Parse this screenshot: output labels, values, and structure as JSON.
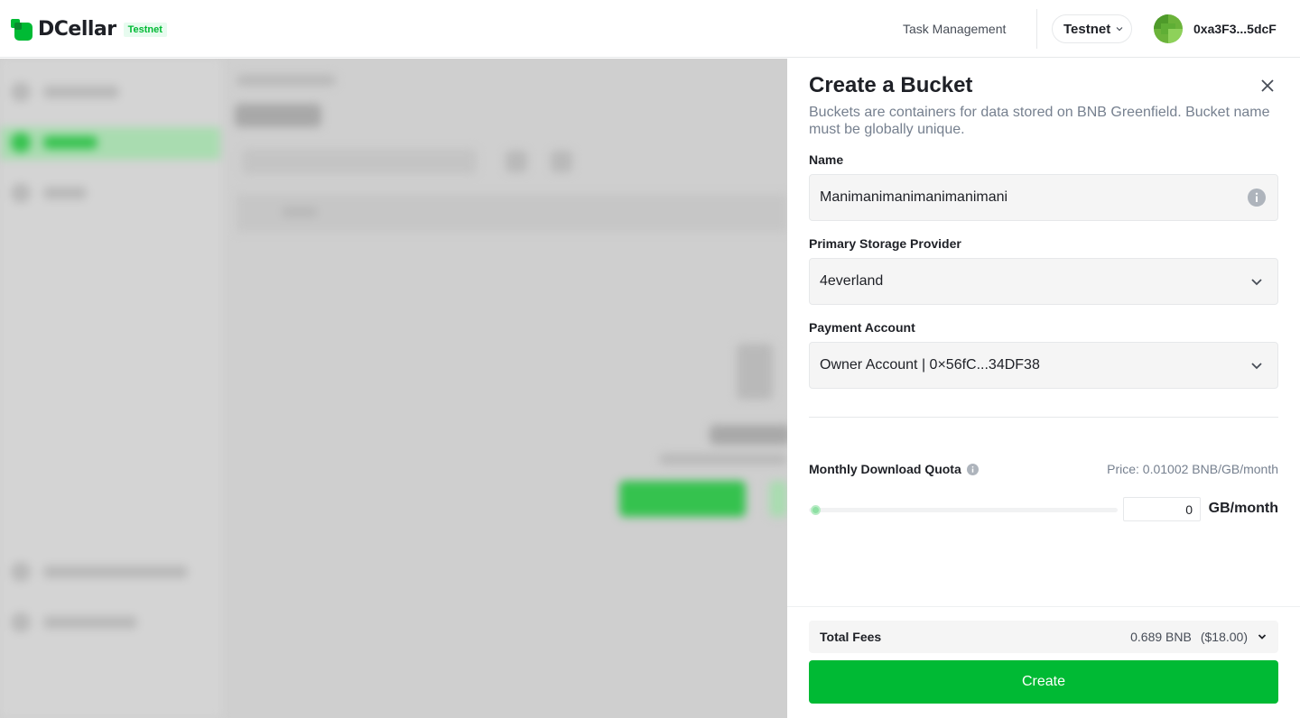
{
  "header": {
    "brand": "DCellar",
    "network_badge": "Testnet",
    "task_management": "Task Management",
    "network_selector": "Testnet",
    "wallet_address": "0xa3F3...5dcF"
  },
  "drawer": {
    "title": "Create a Bucket",
    "description": "Buckets are containers for data stored on BNB Greenfield. Bucket name must be globally unique.",
    "name_label": "Name",
    "name_value": "Manimanimanimanimanimani",
    "provider_label": "Primary Storage Provider",
    "provider_value": "4everland",
    "payment_label": "Payment Account",
    "payment_value": "Owner Account | 0×56fC...34DF38",
    "quota_label": "Monthly Download Quota",
    "quota_price": "Price: 0.01002 BNB/GB/month",
    "quota_value": "0",
    "quota_unit": "GB/month",
    "quota_slider_fraction": 0,
    "fees_label": "Total Fees",
    "fees_value": "0.689 BNB",
    "fees_usd": "($18.00)",
    "create_label": "Create"
  },
  "icons": {
    "close": "close-icon",
    "info": "info-icon",
    "chevron": "chevron-down-icon"
  },
  "colors": {
    "accent": "#00ba34",
    "text": "#1e2026",
    "muted": "#76808f"
  }
}
